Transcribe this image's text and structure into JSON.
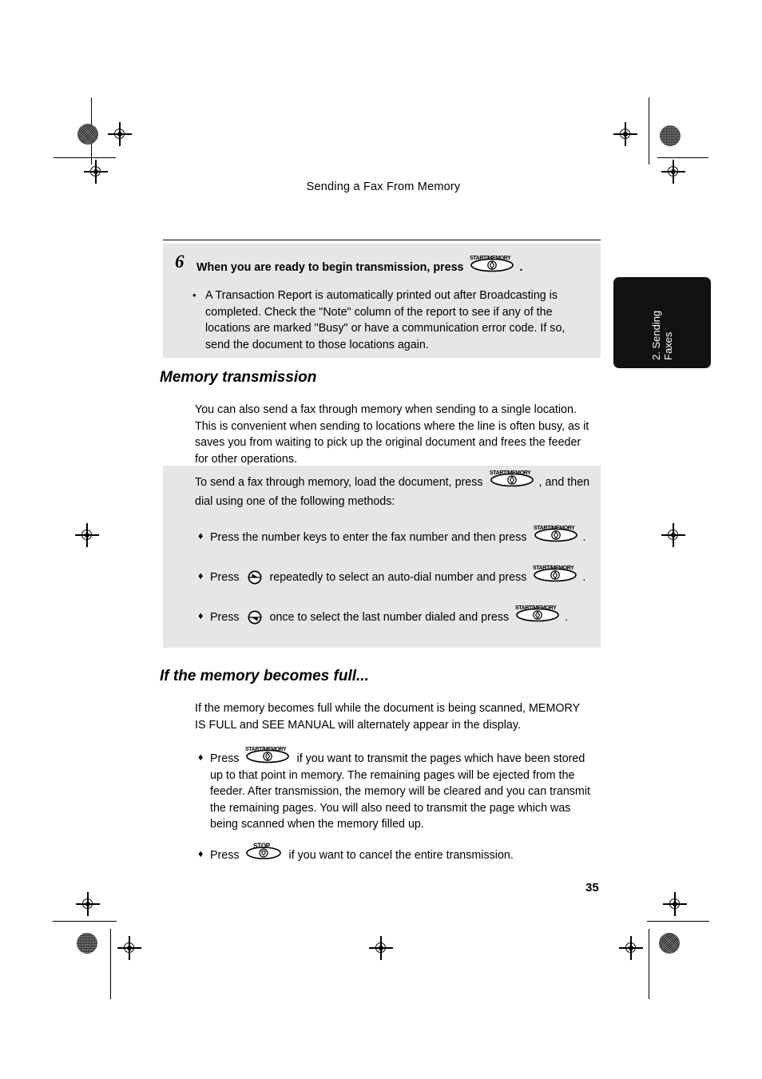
{
  "page": {
    "running_head": "Sending a Fax From Memory",
    "page_number": "35",
    "thumb_tab": "2. Sending\nFaxes",
    "shade_color": "#e6e6e6",
    "tab_color": "#111111"
  },
  "step6": {
    "number": "6",
    "heading_before_key": "When you are ready to begin transmission, press",
    "key_label": "START/MEMORY",
    "heading_after_key": ".",
    "bullet": "A Transaction Report is automatically printed out after Broadcasting is completed. Check the \"Note\" column of the report to see if any of the locations are marked \"Busy\" or have a communication error code. If so, send the document to those locations again."
  },
  "memory_transmission": {
    "heading": "Memory transmission",
    "intro": "You can also send a fax through memory when sending to a single location. This is convenient when sending to locations where the line is often busy, as it saves you from waiting to pick up the original document and frees the feeder for other operations.",
    "lead_before_key": "To send a fax through memory, load the document, press",
    "key_label": "START/MEMORY",
    "lead_after_key": ", and then",
    "lead_line2": "dial using one of the following methods:",
    "methods": [
      {
        "bullet": "♦",
        "text_before_key": "Press the number keys to enter the fax number and then press",
        "arrow_icon": null,
        "key_label": "START/MEMORY",
        "text_after_key": "."
      },
      {
        "bullet": "♦",
        "text_before_arrow": "Press",
        "arrow_icon": "arrow-right-icon",
        "text_before_key": "repeatedly to select an auto-dial number and press",
        "key_label": "START/MEMORY",
        "text_after_key": "."
      },
      {
        "bullet": "♦",
        "text_before_arrow": "Press",
        "arrow_icon": "arrow-left-icon",
        "text_before_key": "once to select the last number dialed and press",
        "key_label": "START/MEMORY",
        "text_after_key": "."
      }
    ]
  },
  "memory_full": {
    "heading": "If the memory becomes full...",
    "intro": "If the memory becomes full while the document is being scanned, MEMORY IS FULL and SEE MANUAL will alternately appear in the display.",
    "items": [
      {
        "bullet": "♦",
        "text_before_key": "Press",
        "key_label": "START/MEMORY",
        "text_after_key": "if you want to transmit the pages which have been stored up to that point in memory. The remaining pages will be ejected from the feeder. After transmission, the memory will be cleared and you can transmit the remaining pages. You will also need to transmit the page which was being scanned when the memory filled up."
      },
      {
        "bullet": "♦",
        "text_before_key": "Press",
        "key_label": "STOP",
        "text_after_key": "if you want to cancel the entire transmission."
      }
    ]
  }
}
